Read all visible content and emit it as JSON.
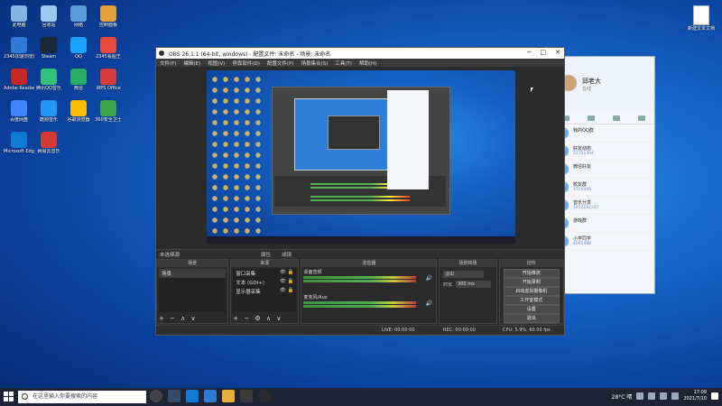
{
  "desktop": {
    "icons": [
      {
        "label": "此电脑",
        "color": "#7fb6e6"
      },
      {
        "label": "回收站",
        "color": "#9cc8f0"
      },
      {
        "label": "网络",
        "color": "#5a9bd8"
      },
      {
        "label": "控制面板",
        "color": "#e4a03a"
      },
      {
        "label": "2345加速浏览器",
        "color": "#2e7bd6"
      },
      {
        "label": "Steam",
        "color": "#1b2838"
      },
      {
        "label": "QQ",
        "color": "#1aa0ff"
      },
      {
        "label": "2345看图王",
        "color": "#e94b3c"
      },
      {
        "label": "Adobe Reader",
        "color": "#c62828"
      },
      {
        "label": "腾讯QQ音乐",
        "color": "#31c27c"
      },
      {
        "label": "微信",
        "color": "#2aae67"
      },
      {
        "label": "WPS Office",
        "color": "#d83b3b"
      },
      {
        "label": "百度网盘",
        "color": "#3f85ff"
      },
      {
        "label": "酷狗音乐",
        "color": "#2196f3"
      },
      {
        "label": "谷歌浏览器",
        "color": "#fbbc05"
      },
      {
        "label": "360安全卫士",
        "color": "#3ca54b"
      },
      {
        "label": "Microsoft Edge",
        "color": "#0f7bd6"
      },
      {
        "label": "网易云音乐",
        "color": "#d33a31"
      }
    ],
    "new_file_label": "新建文本文档"
  },
  "obs": {
    "title": "OBS 26.1.1 (64-bit, windows) - 配置文件: 未命名 - 场景: 未命名",
    "menus": [
      "文件(F)",
      "编辑(E)",
      "视图(V)",
      "停靠部件(D)",
      "配置文件(P)",
      "场景集合(S)",
      "工具(T)",
      "帮助(H)"
    ],
    "status_label": "未选择源",
    "status_tabs": [
      "属性",
      "滤镜"
    ],
    "docks": {
      "scenes": {
        "title": "场景",
        "items": [
          "场景"
        ]
      },
      "sources": {
        "title": "来源",
        "items": [
          {
            "name": "窗口采集"
          },
          {
            "name": "文本 (GDI+)"
          },
          {
            "name": "显示器采集"
          }
        ]
      },
      "mixer": {
        "title": "混音器",
        "tracks": [
          {
            "name": "桌面音频",
            "db": "0.0 dB"
          },
          {
            "name": "麦克风/Aux",
            "db": "0.0 dB"
          }
        ]
      },
      "transitions": {
        "title": "场景转场",
        "selected": "淡出",
        "duration_label": "时长",
        "duration_value": "300 ms"
      },
      "controls": {
        "title": "控件",
        "buttons": [
          "开始推流",
          "开始录制",
          "启动虚拟摄像机",
          "工作室模式",
          "设置",
          "退出"
        ]
      }
    },
    "bottom_status": [
      "LIVE: 00:00:00",
      "REC: 00:00:00",
      "CPU: 5.9%, 60.00 fps"
    ]
  },
  "qq": {
    "name": "邱老大",
    "status": "在线",
    "items": [
      {
        "title": "我的QQ群",
        "sub": ""
      },
      {
        "title": "好友动态",
        "sub": "22751394"
      },
      {
        "title": "微信好友",
        "sub": ""
      },
      {
        "title": "校友群",
        "sub": "4700498"
      },
      {
        "title": "音乐分享",
        "sub": "1452192207"
      },
      {
        "title": "游戏群",
        "sub": ""
      },
      {
        "title": "小学同学",
        "sub": "4095488"
      }
    ]
  },
  "taskbar": {
    "search_placeholder": "在这里输入你要搜索的内容",
    "weather": "28°C 晴",
    "time": "17:09",
    "date": "2021/7/10"
  }
}
